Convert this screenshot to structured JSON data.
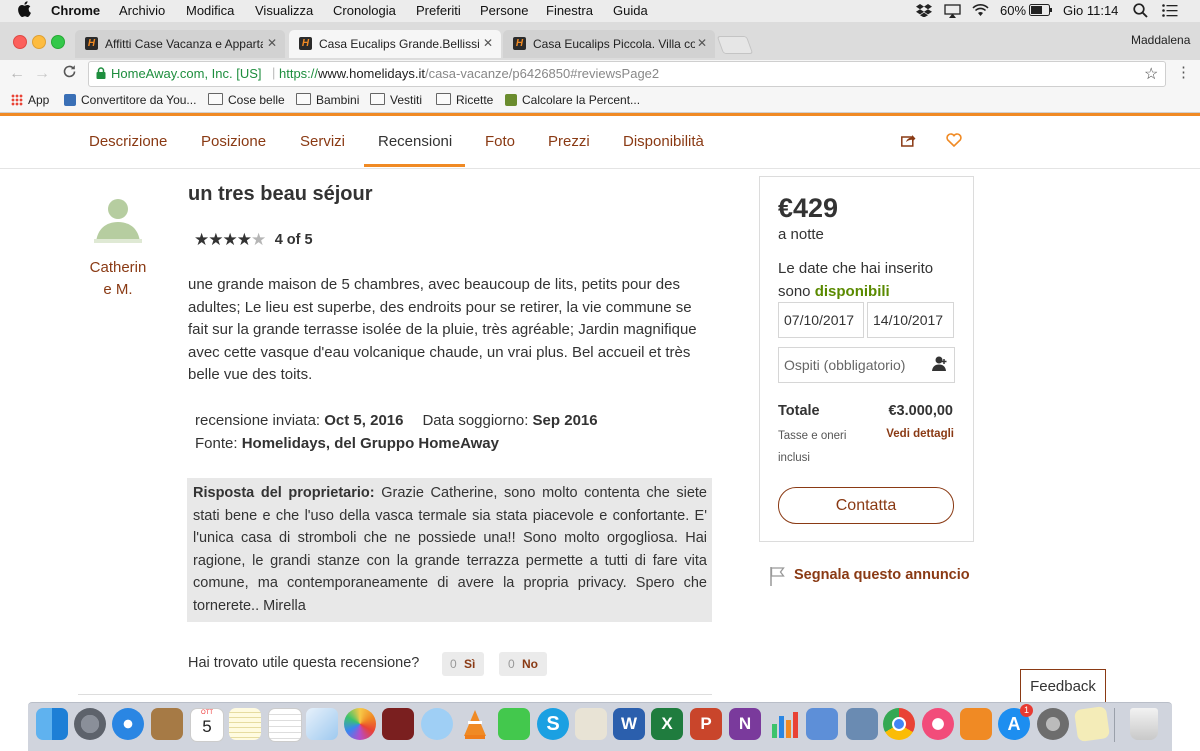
{
  "menubar": {
    "apple": "",
    "items": [
      "Chrome",
      "Archivio",
      "Modifica",
      "Visualizza",
      "Cronologia",
      "Preferiti",
      "Persone",
      "Finestra",
      "Guida"
    ],
    "battery": "60%",
    "clock": "Gio 11:14"
  },
  "browser": {
    "profile": "Maddalena",
    "tabs": [
      {
        "title": "Affitti Case Vacanza e Apparta",
        "fav": "H"
      },
      {
        "title": "Casa Eucalips Grande.Bellissin",
        "fav": "H"
      },
      {
        "title": "Casa Eucalips Piccola. Villa co",
        "fav": "H"
      }
    ],
    "site_identity": "HomeAway.com, Inc. [US]",
    "url_scheme": "https://",
    "url_host": "www.homelidays.it",
    "url_path": "/casa-vacanze/p6426850#reviewsPage2",
    "bookmarks": [
      "App",
      "Convertitore da You...",
      "Cose belle",
      "Bambini",
      "Vestiti",
      "Ricette",
      "Calcolare la Percent..."
    ]
  },
  "subnav": {
    "items": [
      "Descrizione",
      "Posizione",
      "Servizi",
      "Recensioni",
      "Foto",
      "Prezzi",
      "Disponibilità"
    ],
    "active": "Recensioni"
  },
  "review": {
    "author_line1": "Catherin",
    "author_line2": "e M.",
    "title": "un tres beau séjour",
    "rating": 4,
    "rating_max": 5,
    "rating_text": "4 of 5",
    "body": "une grande maison de 5 chambres, avec beaucoup de lits, petits pour des adultes; Le lieu est superbe, des endroits pour se retirer, la vie commune se fait sur la grande terrasse isolée de la pluie, très agréable; Jardin magnifique avec cette vasque d'eau volcanique chaude, un vrai plus. Bel accueil et très belle vue des toits.",
    "sent_label": "recensione inviata:",
    "sent_date": "Oct 5, 2016",
    "stay_label": "Data soggiorno:",
    "stay_date": "Sep 2016",
    "source_label": "Fonte:",
    "source_value": "Homelidays, del Gruppo HomeAway",
    "owner_label": "Risposta del proprietario:",
    "owner_text": "Grazie Catherine, sono molto contenta che siete stati bene e che l'uso della vasca termale sia stata piacevole e confortante. E' l'unica casa di stromboli che ne possiede una!! Sono molto orgogliosa. Hai ragione, le grandi stanze con la grande terrazza permette a tutti di fare vita comune, ma contemporaneamente di avere la propria privacy. Spero che tornerete.. Mirella",
    "helpful_question": "Hai trovato utile questa recensione?",
    "yes_count": "0",
    "yes_label": "Sì",
    "no_count": "0",
    "no_label": "No"
  },
  "booking": {
    "price": "€429",
    "per": "a notte",
    "avail_line1": "Le date che hai inserito",
    "avail_line2": "sono",
    "avail_status": "disponibili",
    "checkin": "07/10/2017",
    "checkout": "14/10/2017",
    "guests_placeholder": "Ospiti (obbligatorio)",
    "total_label": "Totale",
    "total_value": "€3.000,00",
    "taxes_line1": "Tasse e oneri",
    "taxes_line2": "inclusi",
    "details_link": "Vedi dettagli",
    "contact_button": "Contatta",
    "report_link": "Segnala questo annuncio"
  },
  "feedback_button": "Feedback",
  "dock": {
    "calendar_day": "5",
    "calendar_month": "OTT",
    "appstore_badge": "1"
  },
  "colors": {
    "accent_orange": "#f08a24",
    "link_brown": "#8a3a14",
    "available_green": "#5a8a00"
  }
}
